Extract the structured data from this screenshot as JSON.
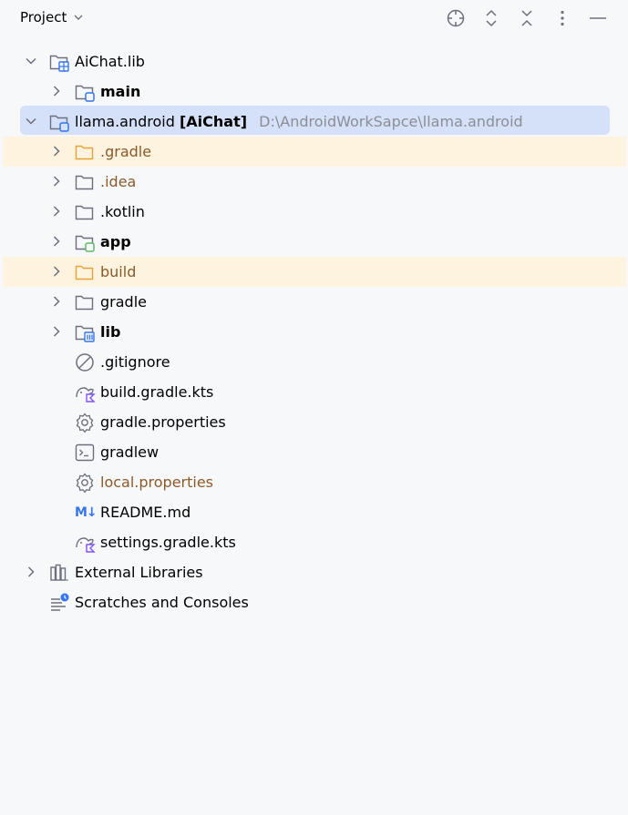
{
  "header": {
    "title": "Project"
  },
  "tree": {
    "items": [
      {
        "label": "AiChat.lib"
      },
      {
        "label": "main"
      },
      {
        "label": "llama.android",
        "module": "[AiChat]",
        "path": "D:\\AndroidWorkSapce\\llama.android"
      },
      {
        "label": ".gradle"
      },
      {
        "label": ".idea"
      },
      {
        "label": ".kotlin"
      },
      {
        "label": "app"
      },
      {
        "label": "build"
      },
      {
        "label": "gradle"
      },
      {
        "label": "lib"
      },
      {
        "label": ".gitignore"
      },
      {
        "label": "build.gradle.kts"
      },
      {
        "label": "gradle.properties"
      },
      {
        "label": "gradlew"
      },
      {
        "label": "local.properties"
      },
      {
        "label": "README.md",
        "icon_text": "M↓"
      },
      {
        "label": "settings.gradle.kts"
      },
      {
        "label": "External Libraries"
      },
      {
        "label": "Scratches and Consoles"
      }
    ]
  },
  "colors": {
    "selection": "#d5e0f9",
    "ignored_highlight": "#fdf3de",
    "ignored_text": "#8a5a2b",
    "module_blue": "#3574f0",
    "module_green": "#5fb865",
    "kotlin_purple": "#7f52ff"
  }
}
